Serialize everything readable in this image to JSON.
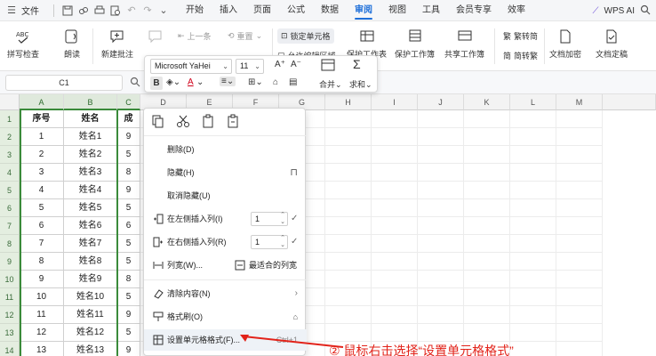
{
  "menubar": {
    "file_label": "文件",
    "tabs": [
      "开始",
      "插入",
      "页面",
      "公式",
      "数据",
      "审阅",
      "视图",
      "工具",
      "会员专享",
      "效率"
    ],
    "active_tab": "审阅",
    "ai_label": "WPS AI"
  },
  "ribbon": {
    "spellcheck": "拼写检查",
    "read_aloud": "朗读",
    "new_comment": "新建批注",
    "prev_item": "上一条",
    "reset": "重置",
    "lock_cell": "锁定单元格",
    "allow_edit": "允许编辑区域",
    "protect_sheet": "保护工作表",
    "protect_workbook": "保护工作簿",
    "share_workbook": "共享工作簿",
    "to_simplified": "繁转简",
    "to_traditional": "简转繁",
    "doc_encrypt": "文档加密",
    "doc_finalize": "文档定稿"
  },
  "formula_bar": {
    "cell_ref": "C1"
  },
  "columns": [
    "A",
    "B",
    "C",
    "D",
    "E",
    "F",
    "G",
    "H",
    "I",
    "J",
    "K",
    "L",
    "M"
  ],
  "rows": [
    {
      "num": "1",
      "a": "序号",
      "b": "姓名",
      "c": "成"
    },
    {
      "num": "2",
      "a": "1",
      "b": "姓名1",
      "c": "9"
    },
    {
      "num": "3",
      "a": "2",
      "b": "姓名2",
      "c": "5"
    },
    {
      "num": "4",
      "a": "3",
      "b": "姓名3",
      "c": "8"
    },
    {
      "num": "5",
      "a": "4",
      "b": "姓名4",
      "c": "9"
    },
    {
      "num": "6",
      "a": "5",
      "b": "姓名5",
      "c": "5"
    },
    {
      "num": "7",
      "a": "6",
      "b": "姓名6",
      "c": "6"
    },
    {
      "num": "8",
      "a": "7",
      "b": "姓名7",
      "c": "5"
    },
    {
      "num": "9",
      "a": "8",
      "b": "姓名8",
      "c": "5"
    },
    {
      "num": "10",
      "a": "9",
      "b": "姓名9",
      "c": "8"
    },
    {
      "num": "11",
      "a": "10",
      "b": "姓名10",
      "c": "5"
    },
    {
      "num": "12",
      "a": "11",
      "b": "姓名11",
      "c": "9"
    },
    {
      "num": "13",
      "a": "12",
      "b": "姓名12",
      "c": "5"
    },
    {
      "num": "14",
      "a": "13",
      "b": "姓名13",
      "c": "9"
    }
  ],
  "minibar": {
    "font_name": "Microsoft YaHei",
    "font_size": "11",
    "bold": "B",
    "font_color_label": "A",
    "merge": "合并",
    "sum": "求和"
  },
  "context_menu": {
    "delete": "删除(D)",
    "hide": "隐藏(H)",
    "unhide": "取消隐藏(U)",
    "insert_left": "在左侧插入列(I)",
    "insert_left_count": "1",
    "insert_right": "在右侧插入列(R)",
    "insert_right_count": "1",
    "col_width": "列宽(W)...",
    "best_fit": "最适合的列宽",
    "clear": "清除内容(N)",
    "format_painter": "格式刷(O)",
    "format_cells": "设置单元格格式(F)...",
    "format_cells_shortcut": "Ctrl+1"
  },
  "annotation": {
    "text": "② 鼠标右击选择“设置单元格格式”"
  },
  "colors": {
    "accent": "#1e6fd9",
    "selection_green": "#3a8a3a",
    "annotation_red": "#e2231a"
  }
}
